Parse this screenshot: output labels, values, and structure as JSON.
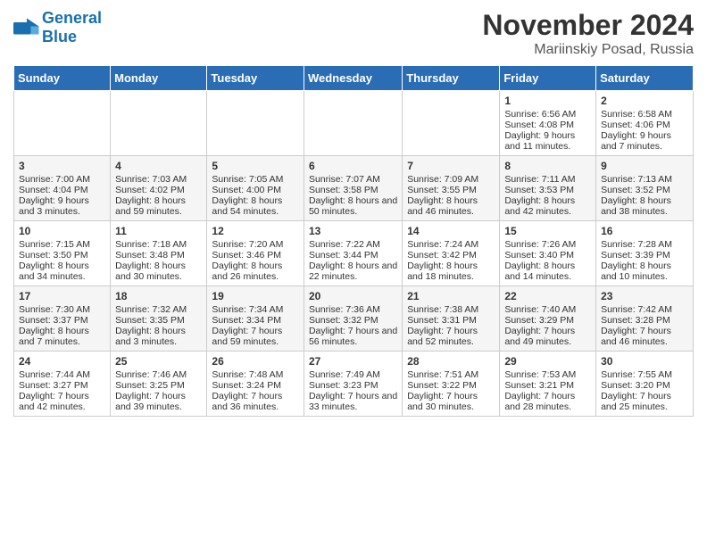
{
  "header": {
    "logo_general": "General",
    "logo_blue": "Blue",
    "month_title": "November 2024",
    "location": "Mariinskiy Posad, Russia"
  },
  "days_of_week": [
    "Sunday",
    "Monday",
    "Tuesday",
    "Wednesday",
    "Thursday",
    "Friday",
    "Saturday"
  ],
  "weeks": [
    [
      {
        "day": "",
        "sunrise": "",
        "sunset": "",
        "daylight": ""
      },
      {
        "day": "",
        "sunrise": "",
        "sunset": "",
        "daylight": ""
      },
      {
        "day": "",
        "sunrise": "",
        "sunset": "",
        "daylight": ""
      },
      {
        "day": "",
        "sunrise": "",
        "sunset": "",
        "daylight": ""
      },
      {
        "day": "",
        "sunrise": "",
        "sunset": "",
        "daylight": ""
      },
      {
        "day": "1",
        "sunrise": "Sunrise: 6:56 AM",
        "sunset": "Sunset: 4:08 PM",
        "daylight": "Daylight: 9 hours and 11 minutes."
      },
      {
        "day": "2",
        "sunrise": "Sunrise: 6:58 AM",
        "sunset": "Sunset: 4:06 PM",
        "daylight": "Daylight: 9 hours and 7 minutes."
      }
    ],
    [
      {
        "day": "3",
        "sunrise": "Sunrise: 7:00 AM",
        "sunset": "Sunset: 4:04 PM",
        "daylight": "Daylight: 9 hours and 3 minutes."
      },
      {
        "day": "4",
        "sunrise": "Sunrise: 7:03 AM",
        "sunset": "Sunset: 4:02 PM",
        "daylight": "Daylight: 8 hours and 59 minutes."
      },
      {
        "day": "5",
        "sunrise": "Sunrise: 7:05 AM",
        "sunset": "Sunset: 4:00 PM",
        "daylight": "Daylight: 8 hours and 54 minutes."
      },
      {
        "day": "6",
        "sunrise": "Sunrise: 7:07 AM",
        "sunset": "Sunset: 3:58 PM",
        "daylight": "Daylight: 8 hours and 50 minutes."
      },
      {
        "day": "7",
        "sunrise": "Sunrise: 7:09 AM",
        "sunset": "Sunset: 3:55 PM",
        "daylight": "Daylight: 8 hours and 46 minutes."
      },
      {
        "day": "8",
        "sunrise": "Sunrise: 7:11 AM",
        "sunset": "Sunset: 3:53 PM",
        "daylight": "Daylight: 8 hours and 42 minutes."
      },
      {
        "day": "9",
        "sunrise": "Sunrise: 7:13 AM",
        "sunset": "Sunset: 3:52 PM",
        "daylight": "Daylight: 8 hours and 38 minutes."
      }
    ],
    [
      {
        "day": "10",
        "sunrise": "Sunrise: 7:15 AM",
        "sunset": "Sunset: 3:50 PM",
        "daylight": "Daylight: 8 hours and 34 minutes."
      },
      {
        "day": "11",
        "sunrise": "Sunrise: 7:18 AM",
        "sunset": "Sunset: 3:48 PM",
        "daylight": "Daylight: 8 hours and 30 minutes."
      },
      {
        "day": "12",
        "sunrise": "Sunrise: 7:20 AM",
        "sunset": "Sunset: 3:46 PM",
        "daylight": "Daylight: 8 hours and 26 minutes."
      },
      {
        "day": "13",
        "sunrise": "Sunrise: 7:22 AM",
        "sunset": "Sunset: 3:44 PM",
        "daylight": "Daylight: 8 hours and 22 minutes."
      },
      {
        "day": "14",
        "sunrise": "Sunrise: 7:24 AM",
        "sunset": "Sunset: 3:42 PM",
        "daylight": "Daylight: 8 hours and 18 minutes."
      },
      {
        "day": "15",
        "sunrise": "Sunrise: 7:26 AM",
        "sunset": "Sunset: 3:40 PM",
        "daylight": "Daylight: 8 hours and 14 minutes."
      },
      {
        "day": "16",
        "sunrise": "Sunrise: 7:28 AM",
        "sunset": "Sunset: 3:39 PM",
        "daylight": "Daylight: 8 hours and 10 minutes."
      }
    ],
    [
      {
        "day": "17",
        "sunrise": "Sunrise: 7:30 AM",
        "sunset": "Sunset: 3:37 PM",
        "daylight": "Daylight: 8 hours and 7 minutes."
      },
      {
        "day": "18",
        "sunrise": "Sunrise: 7:32 AM",
        "sunset": "Sunset: 3:35 PM",
        "daylight": "Daylight: 8 hours and 3 minutes."
      },
      {
        "day": "19",
        "sunrise": "Sunrise: 7:34 AM",
        "sunset": "Sunset: 3:34 PM",
        "daylight": "Daylight: 7 hours and 59 minutes."
      },
      {
        "day": "20",
        "sunrise": "Sunrise: 7:36 AM",
        "sunset": "Sunset: 3:32 PM",
        "daylight": "Daylight: 7 hours and 56 minutes."
      },
      {
        "day": "21",
        "sunrise": "Sunrise: 7:38 AM",
        "sunset": "Sunset: 3:31 PM",
        "daylight": "Daylight: 7 hours and 52 minutes."
      },
      {
        "day": "22",
        "sunrise": "Sunrise: 7:40 AM",
        "sunset": "Sunset: 3:29 PM",
        "daylight": "Daylight: 7 hours and 49 minutes."
      },
      {
        "day": "23",
        "sunrise": "Sunrise: 7:42 AM",
        "sunset": "Sunset: 3:28 PM",
        "daylight": "Daylight: 7 hours and 46 minutes."
      }
    ],
    [
      {
        "day": "24",
        "sunrise": "Sunrise: 7:44 AM",
        "sunset": "Sunset: 3:27 PM",
        "daylight": "Daylight: 7 hours and 42 minutes."
      },
      {
        "day": "25",
        "sunrise": "Sunrise: 7:46 AM",
        "sunset": "Sunset: 3:25 PM",
        "daylight": "Daylight: 7 hours and 39 minutes."
      },
      {
        "day": "26",
        "sunrise": "Sunrise: 7:48 AM",
        "sunset": "Sunset: 3:24 PM",
        "daylight": "Daylight: 7 hours and 36 minutes."
      },
      {
        "day": "27",
        "sunrise": "Sunrise: 7:49 AM",
        "sunset": "Sunset: 3:23 PM",
        "daylight": "Daylight: 7 hours and 33 minutes."
      },
      {
        "day": "28",
        "sunrise": "Sunrise: 7:51 AM",
        "sunset": "Sunset: 3:22 PM",
        "daylight": "Daylight: 7 hours and 30 minutes."
      },
      {
        "day": "29",
        "sunrise": "Sunrise: 7:53 AM",
        "sunset": "Sunset: 3:21 PM",
        "daylight": "Daylight: 7 hours and 28 minutes."
      },
      {
        "day": "30",
        "sunrise": "Sunrise: 7:55 AM",
        "sunset": "Sunset: 3:20 PM",
        "daylight": "Daylight: 7 hours and 25 minutes."
      }
    ]
  ]
}
